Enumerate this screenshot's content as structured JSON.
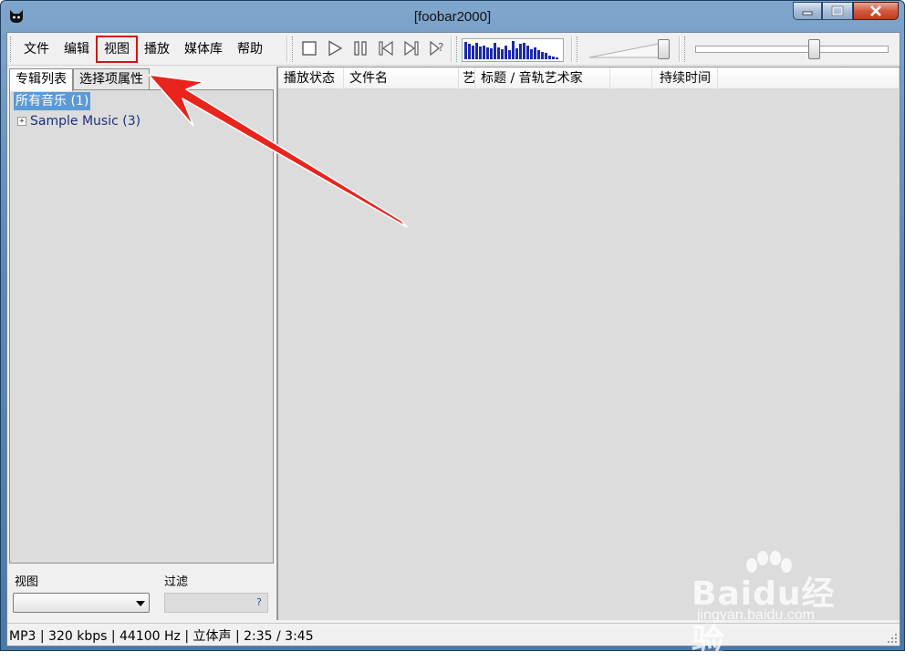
{
  "window": {
    "title": "[foobar2000]",
    "icon": "foobar-cat-icon"
  },
  "caption_buttons": [
    "minimize-icon",
    "maximize-icon",
    "close-icon"
  ],
  "menu": {
    "items": [
      {
        "label": "文件"
      },
      {
        "label": "编辑"
      },
      {
        "label": "视图",
        "highlighted": true
      },
      {
        "label": "播放"
      },
      {
        "label": "媒体库"
      },
      {
        "label": "帮助"
      }
    ]
  },
  "transport": [
    "stop-icon",
    "play-icon",
    "pause-icon",
    "previous-icon",
    "next-icon",
    "random-icon"
  ],
  "visualizer": {
    "levels": [
      0.85,
      0.75,
      0.7,
      0.8,
      0.65,
      0.7,
      0.6,
      0.55,
      0.8,
      0.6,
      0.5,
      0.7,
      0.45,
      0.9,
      0.55,
      0.75,
      0.8,
      0.7,
      0.5,
      0.6,
      0.45,
      0.35,
      0.3,
      0.2,
      0.15,
      0.1
    ],
    "bar_color": "#1a2aa8"
  },
  "volume": {
    "level": 1.0
  },
  "seek": {
    "position": 0.62
  },
  "left_panel": {
    "tabs": [
      {
        "label": "专辑列表",
        "selected": true
      },
      {
        "label": "选择项属性",
        "selected": false
      }
    ],
    "tree": {
      "root": "所有音乐 (1)",
      "child": "Sample Music (3)",
      "expander": "+"
    },
    "view_label": "视图",
    "filter_label": "过滤",
    "filter_help": "?",
    "view_value": ""
  },
  "playlist": {
    "columns": [
      "播放状态",
      "文件名",
      "艺",
      "标题 / 音轨艺术家",
      "",
      "持续时间"
    ]
  },
  "status_bar": {
    "text": "MP3 | 320 kbps | 44100 Hz | 立体声 | 2:35 / 3:45"
  },
  "watermark": {
    "brand": "Baidu经验",
    "url": "jingyan.baidu.com"
  },
  "colors": {
    "highlight_box": "#d0131b",
    "arrow": "#e8241c",
    "selection": "#5c9ad6"
  }
}
